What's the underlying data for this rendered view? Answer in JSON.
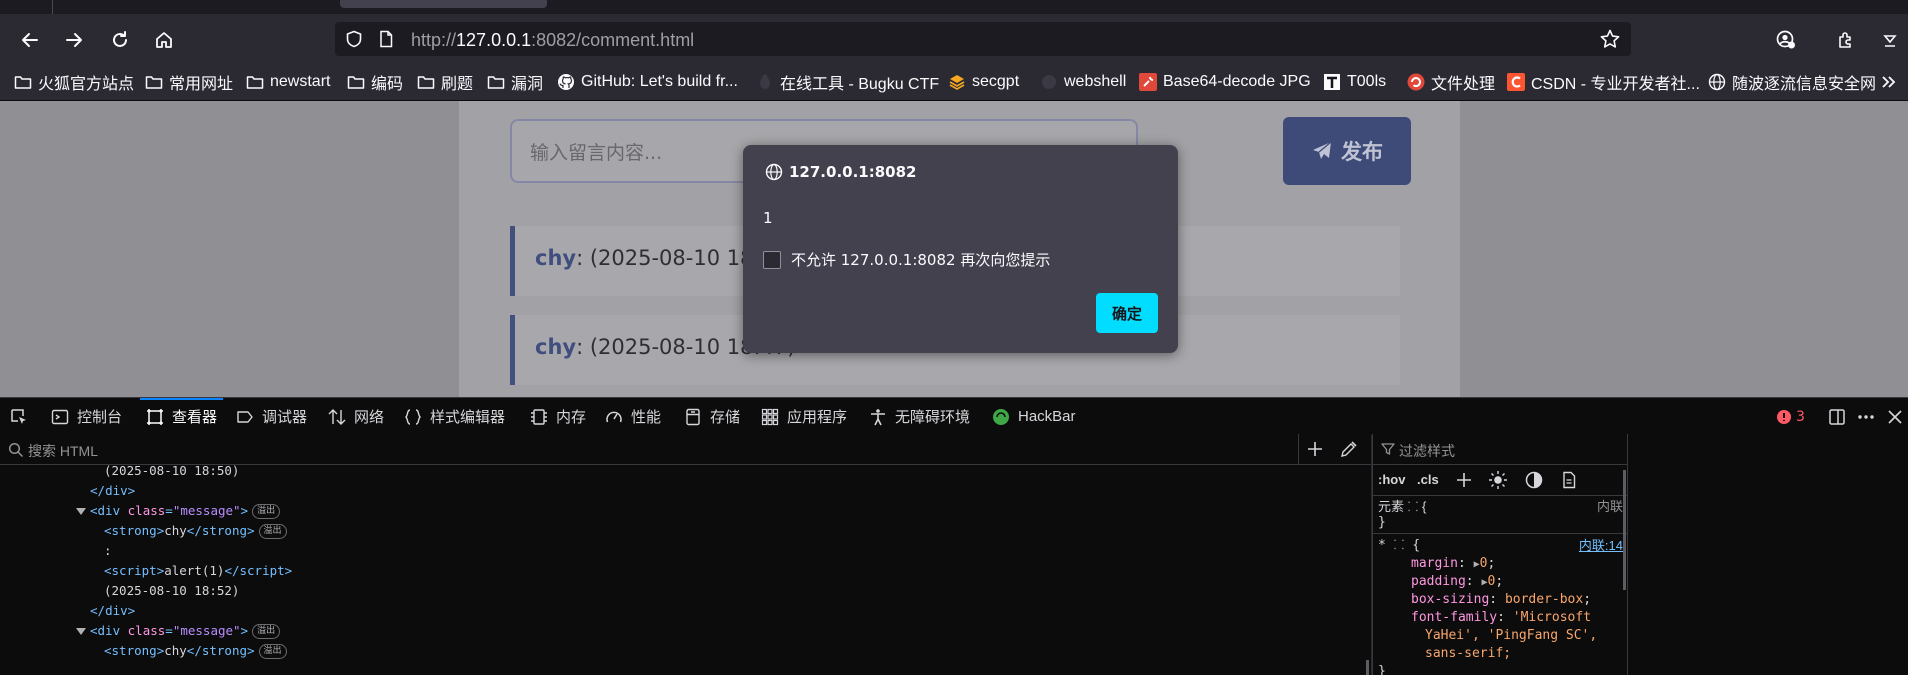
{
  "browser": {
    "url_prefix": "http://",
    "url_host": "127.0.0.1",
    "url_rest": ":8082/comment.html",
    "bookmarks": [
      {
        "label": "火狐官方站点",
        "icon": "folder-icon"
      },
      {
        "label": "常用网址",
        "icon": "folder-icon"
      },
      {
        "label": "newstart",
        "icon": "folder-icon"
      },
      {
        "label": "编码",
        "icon": "folder-icon"
      },
      {
        "label": "刷题",
        "icon": "folder-icon"
      },
      {
        "label": "漏洞",
        "icon": "folder-icon"
      },
      {
        "label": "GitHub: Let's build fr...",
        "icon": "github-icon"
      },
      {
        "label": "在线工具 - Bugku CTF",
        "icon": "bugku-icon"
      },
      {
        "label": "secgpt",
        "icon": "secgpt-icon"
      },
      {
        "label": "webshell",
        "icon": "webshell-icon"
      },
      {
        "label": "Base64-decode JPG",
        "icon": "tool-icon"
      },
      {
        "label": "T00ls",
        "icon": "t00ls-icon"
      },
      {
        "label": "文件处理",
        "icon": "file-process-icon"
      },
      {
        "label": "CSDN - 专业开发者社...",
        "icon": "csdn-icon"
      },
      {
        "label": "随波逐流信息安全网",
        "icon": "globe-icon"
      }
    ]
  },
  "page": {
    "input_placeholder": "输入留言内容...",
    "publish_label": "发布",
    "messages": [
      {
        "author": "chy",
        "text": ": (2025-08-10 18:4"
      },
      {
        "author": "chy",
        "text": ": (2025-08-10 18:47)"
      }
    ]
  },
  "dialog": {
    "origin": "127.0.0.1:8082",
    "message": "1",
    "checkbox_label": "不允许 127.0.0.1:8082 再次向您提示",
    "ok_label": "确定"
  },
  "devtools": {
    "tabs": [
      {
        "label": "控制台",
        "icon": "console-icon"
      },
      {
        "label": "查看器",
        "icon": "inspector-icon"
      },
      {
        "label": "调试器",
        "icon": "debugger-icon"
      },
      {
        "label": "网络",
        "icon": "network-icon"
      },
      {
        "label": "样式编辑器",
        "icon": "style-editor-icon"
      },
      {
        "label": "内存",
        "icon": "memory-icon"
      },
      {
        "label": "性能",
        "icon": "performance-icon"
      },
      {
        "label": "存储",
        "icon": "storage-icon"
      },
      {
        "label": "应用程序",
        "icon": "application-icon"
      },
      {
        "label": "无障碍环境",
        "icon": "accessibility-icon"
      },
      {
        "label": "HackBar",
        "icon": "hackbar-icon"
      }
    ],
    "error_count": "3",
    "search_placeholder": "搜索 HTML",
    "filter_styles_placeholder": "过滤样式",
    "markup": {
      "line1_text": "(2025-08-10 18:50)",
      "line4_text": "(2025-08-10 18:52)",
      "tag_div": "div",
      "attr_class": "class",
      "val_message": "\"message\"",
      "tag_strong": "strong",
      "strong_text": "chy",
      "colon": ":",
      "tag_script": "script",
      "script_text": "alert(1)",
      "badge": "溢出"
    },
    "rules": {
      "hov": ":hov",
      "cls": ".cls",
      "element_label": "元素",
      "element_source": "内联",
      "star_source": "内联:14",
      "decls": [
        {
          "prop": "margin",
          "value": "0"
        },
        {
          "prop": "padding",
          "value": "0"
        },
        {
          "prop": "box-sizing",
          "value": "border-box"
        },
        {
          "prop": "font-family",
          "value": "'Microsoft"
        }
      ],
      "font_cont1": "YaHei', 'PingFang SC',",
      "font_cont2": "sans-serif;"
    }
  }
}
